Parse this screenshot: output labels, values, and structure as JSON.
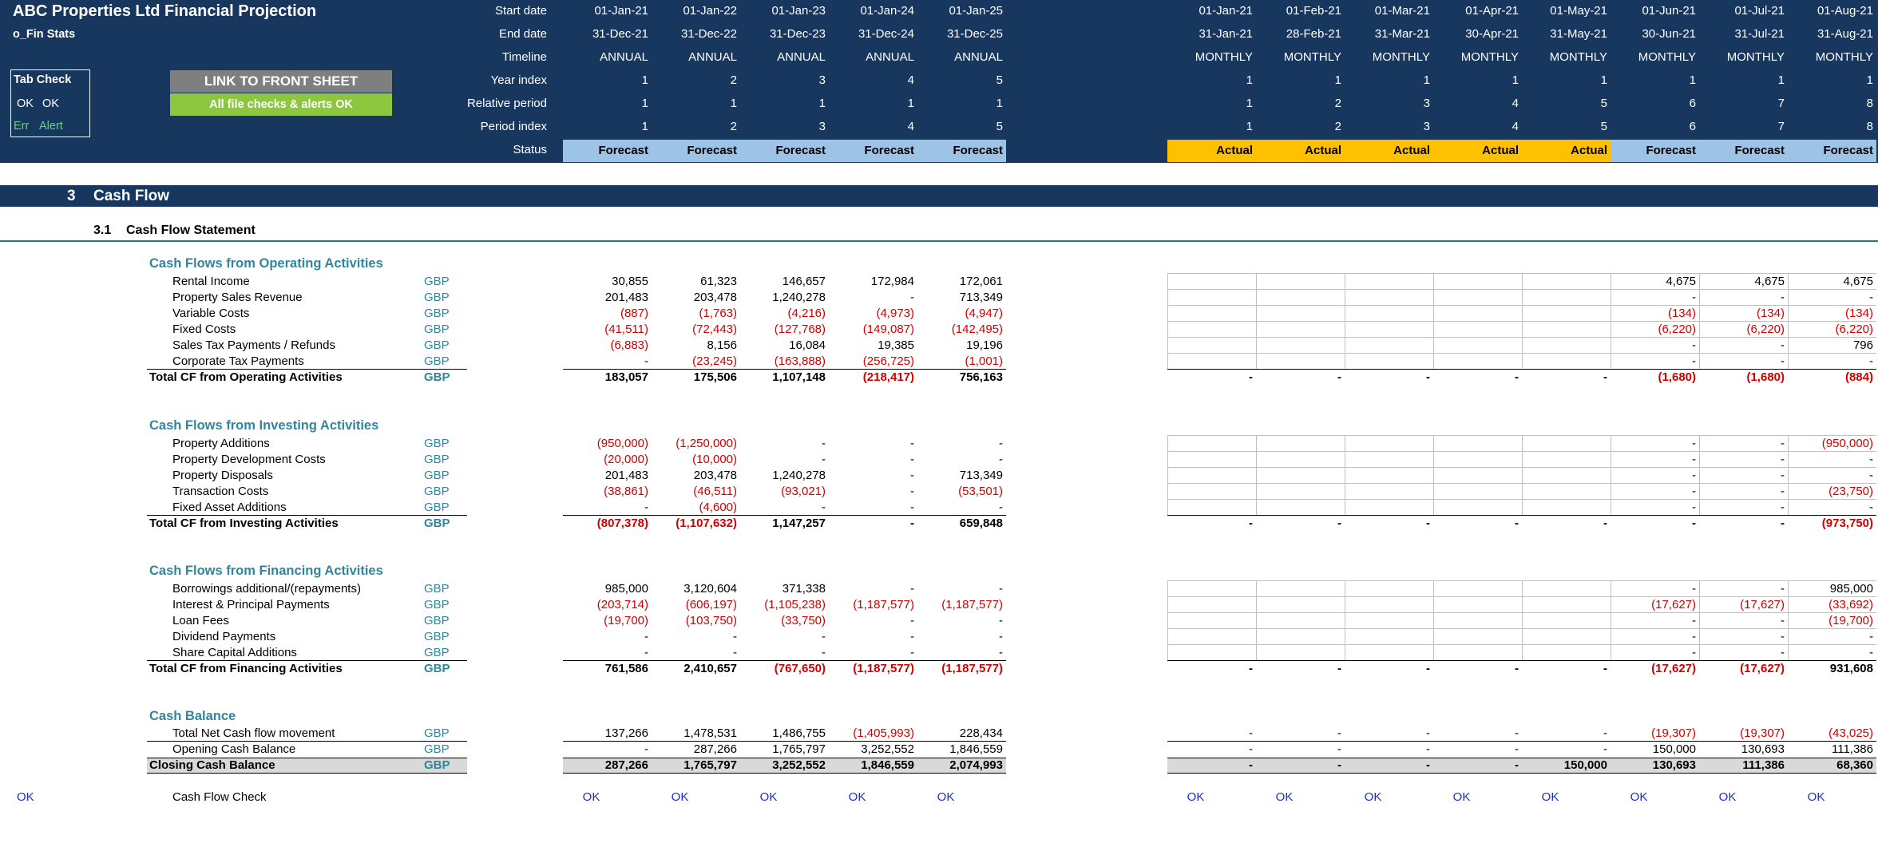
{
  "header": {
    "title": "ABC Properties Ltd Financial Projection",
    "sheet_name": "o_Fin Stats",
    "tab_check_label": "Tab Check",
    "ok1": "OK",
    "ok2": "OK",
    "err_label": "Err",
    "alert_label": "Alert",
    "link_button": "LINK TO FRONT SHEET",
    "checks_button": "All file checks & alerts OK",
    "row_labels": [
      "Start date",
      "End date",
      "Timeline",
      "Year index",
      "Relative period",
      "Period index",
      "Status"
    ]
  },
  "annual_headers": [
    {
      "start": "01-Jan-21",
      "end": "31-Dec-21",
      "timeline": "ANNUAL",
      "year": "1",
      "rel": "1",
      "period": "1",
      "status": "Forecast"
    },
    {
      "start": "01-Jan-22",
      "end": "31-Dec-22",
      "timeline": "ANNUAL",
      "year": "2",
      "rel": "1",
      "period": "2",
      "status": "Forecast"
    },
    {
      "start": "01-Jan-23",
      "end": "31-Dec-23",
      "timeline": "ANNUAL",
      "year": "3",
      "rel": "1",
      "period": "3",
      "status": "Forecast"
    },
    {
      "start": "01-Jan-24",
      "end": "31-Dec-24",
      "timeline": "ANNUAL",
      "year": "4",
      "rel": "1",
      "period": "4",
      "status": "Forecast"
    },
    {
      "start": "01-Jan-25",
      "end": "31-Dec-25",
      "timeline": "ANNUAL",
      "year": "5",
      "rel": "1",
      "period": "5",
      "status": "Forecast"
    }
  ],
  "monthly_headers": [
    {
      "start": "01-Jan-21",
      "end": "31-Jan-21",
      "timeline": "MONTHLY",
      "year": "1",
      "rel": "1",
      "period": "1",
      "status": "Actual"
    },
    {
      "start": "01-Feb-21",
      "end": "28-Feb-21",
      "timeline": "MONTHLY",
      "year": "1",
      "rel": "2",
      "period": "2",
      "status": "Actual"
    },
    {
      "start": "01-Mar-21",
      "end": "31-Mar-21",
      "timeline": "MONTHLY",
      "year": "1",
      "rel": "3",
      "period": "3",
      "status": "Actual"
    },
    {
      "start": "01-Apr-21",
      "end": "30-Apr-21",
      "timeline": "MONTHLY",
      "year": "1",
      "rel": "4",
      "period": "4",
      "status": "Actual"
    },
    {
      "start": "01-May-21",
      "end": "31-May-21",
      "timeline": "MONTHLY",
      "year": "1",
      "rel": "5",
      "period": "5",
      "status": "Actual"
    },
    {
      "start": "01-Jun-21",
      "end": "30-Jun-21",
      "timeline": "MONTHLY",
      "year": "1",
      "rel": "6",
      "period": "6",
      "status": "Forecast"
    },
    {
      "start": "01-Jul-21",
      "end": "31-Jul-21",
      "timeline": "MONTHLY",
      "year": "1",
      "rel": "7",
      "period": "7",
      "status": "Forecast"
    },
    {
      "start": "01-Aug-21",
      "end": "31-Aug-21",
      "timeline": "MONTHLY",
      "year": "1",
      "rel": "8",
      "period": "8",
      "status": "Forecast"
    }
  ],
  "section": {
    "number": "3",
    "title": "Cash Flow",
    "sub_number": "3.1",
    "sub_title": "Cash Flow Statement"
  },
  "colors": {
    "header_bg": "#17375e",
    "forecast": "#9dc3e6",
    "actual": "#ffc000",
    "accent": "#31859c",
    "negative": "#d00000",
    "ok_green": "#8dc63f"
  },
  "groups": [
    {
      "title": "Cash Flows from Operating Activities",
      "rows": [
        {
          "label": "Rental Income",
          "unit": "GBP",
          "annual": [
            "30,855",
            "61,323",
            "146,657",
            "172,984",
            "172,061"
          ],
          "monthly": [
            "",
            "",
            "",
            "",
            "",
            "4,675",
            "4,675",
            "4,675"
          ]
        },
        {
          "label": "Property Sales Revenue",
          "unit": "GBP",
          "annual": [
            "201,483",
            "203,478",
            "1,240,278",
            "-",
            "713,349"
          ],
          "monthly": [
            "",
            "",
            "",
            "",
            "",
            "-",
            "-",
            "-"
          ]
        },
        {
          "label": "Variable Costs",
          "unit": "GBP",
          "annual": [
            "(887)",
            "(1,763)",
            "(4,216)",
            "(4,973)",
            "(4,947)"
          ],
          "monthly": [
            "",
            "",
            "",
            "",
            "",
            "(134)",
            "(134)",
            "(134)"
          ]
        },
        {
          "label": "Fixed Costs",
          "unit": "GBP",
          "annual": [
            "(41,511)",
            "(72,443)",
            "(127,768)",
            "(149,087)",
            "(142,495)"
          ],
          "monthly": [
            "",
            "",
            "",
            "",
            "",
            "(6,220)",
            "(6,220)",
            "(6,220)"
          ]
        },
        {
          "label": "Sales Tax Payments / Refunds",
          "unit": "GBP",
          "annual": [
            "(6,883)",
            "8,156",
            "16,084",
            "19,385",
            "19,196"
          ],
          "monthly": [
            "",
            "",
            "",
            "",
            "",
            "-",
            "-",
            "796"
          ]
        },
        {
          "label": "Corporate Tax Payments",
          "unit": "GBP",
          "annual": [
            "-",
            "(23,245)",
            "(163,888)",
            "(256,725)",
            "(1,001)"
          ],
          "monthly": [
            "",
            "",
            "",
            "",
            "",
            "-",
            "-",
            "-"
          ]
        }
      ],
      "total": {
        "label": "Total CF from Operating Activities",
        "unit": "GBP",
        "annual": [
          "183,057",
          "175,506",
          "1,107,148",
          "(218,417)",
          "756,163"
        ],
        "monthly": [
          "-",
          "-",
          "-",
          "-",
          "-",
          "(1,680)",
          "(1,680)",
          "(884)"
        ]
      }
    },
    {
      "title": "Cash Flows from Investing Activities",
      "rows": [
        {
          "label": "Property Additions",
          "unit": "GBP",
          "annual": [
            "(950,000)",
            "(1,250,000)",
            "-",
            "-",
            "-"
          ],
          "monthly": [
            "",
            "",
            "",
            "",
            "",
            "-",
            "-",
            "(950,000)"
          ]
        },
        {
          "label": "Property Development Costs",
          "unit": "GBP",
          "annual": [
            "(20,000)",
            "(10,000)",
            "-",
            "-",
            "-"
          ],
          "monthly": [
            "",
            "",
            "",
            "",
            "",
            "-",
            "-",
            "-"
          ]
        },
        {
          "label": "Property Disposals",
          "unit": "GBP",
          "annual": [
            "201,483",
            "203,478",
            "1,240,278",
            "-",
            "713,349"
          ],
          "monthly": [
            "",
            "",
            "",
            "",
            "",
            "-",
            "-",
            "-"
          ]
        },
        {
          "label": "Transaction Costs",
          "unit": "GBP",
          "annual": [
            "(38,861)",
            "(46,511)",
            "(93,021)",
            "-",
            "(53,501)"
          ],
          "monthly": [
            "",
            "",
            "",
            "",
            "",
            "-",
            "-",
            "(23,750)"
          ]
        },
        {
          "label": "Fixed Asset Additions",
          "unit": "GBP",
          "annual": [
            "-",
            "(4,600)",
            "-",
            "-",
            "-"
          ],
          "monthly": [
            "",
            "",
            "",
            "",
            "",
            "-",
            "-",
            "-"
          ]
        }
      ],
      "total": {
        "label": "Total CF from Investing Activities",
        "unit": "GBP",
        "annual": [
          "(807,378)",
          "(1,107,632)",
          "1,147,257",
          "-",
          "659,848"
        ],
        "monthly": [
          "-",
          "-",
          "-",
          "-",
          "-",
          "-",
          "-",
          "(973,750)"
        ]
      }
    },
    {
      "title": "Cash Flows from Financing Activities",
      "rows": [
        {
          "label": "Borrowings additional/(repayments)",
          "unit": "GBP",
          "annual": [
            "985,000",
            "3,120,604",
            "371,338",
            "-",
            "-"
          ],
          "monthly": [
            "",
            "",
            "",
            "",
            "",
            "-",
            "-",
            "985,000"
          ]
        },
        {
          "label": "Interest & Principal Payments",
          "unit": "GBP",
          "annual": [
            "(203,714)",
            "(606,197)",
            "(1,105,238)",
            "(1,187,577)",
            "(1,187,577)"
          ],
          "monthly": [
            "",
            "",
            "",
            "",
            "",
            "(17,627)",
            "(17,627)",
            "(33,692)"
          ]
        },
        {
          "label": "Loan Fees",
          "unit": "GBP",
          "annual": [
            "(19,700)",
            "(103,750)",
            "(33,750)",
            "-",
            "-"
          ],
          "monthly": [
            "",
            "",
            "",
            "",
            "",
            "-",
            "-",
            "(19,700)"
          ]
        },
        {
          "label": "Dividend Payments",
          "unit": "GBP",
          "annual": [
            "-",
            "-",
            "-",
            "-",
            "-"
          ],
          "monthly": [
            "",
            "",
            "",
            "",
            "",
            "-",
            "-",
            "-"
          ]
        },
        {
          "label": "Share Capital Additions",
          "unit": "GBP",
          "annual": [
            "-",
            "-",
            "-",
            "-",
            "-"
          ],
          "monthly": [
            "",
            "",
            "",
            "",
            "",
            "-",
            "-",
            "-"
          ]
        }
      ],
      "total": {
        "label": "Total CF from Financing Activities",
        "unit": "GBP",
        "annual": [
          "761,586",
          "2,410,657",
          "(767,650)",
          "(1,187,577)",
          "(1,187,577)"
        ],
        "monthly": [
          "-",
          "-",
          "-",
          "-",
          "-",
          "(17,627)",
          "(17,627)",
          "931,608"
        ]
      }
    }
  ],
  "cash_balance": {
    "title": "Cash Balance",
    "net_movement": {
      "label": "Total Net Cash flow movement",
      "unit": "GBP",
      "annual": [
        "137,266",
        "1,478,531",
        "1,486,755",
        "(1,405,993)",
        "228,434"
      ],
      "monthly": [
        "-",
        "-",
        "-",
        "-",
        "-",
        "(19,307)",
        "(19,307)",
        "(43,025)"
      ]
    },
    "opening": {
      "label": "Opening Cash Balance",
      "unit": "GBP",
      "annual": [
        "-",
        "287,266",
        "1,765,797",
        "3,252,552",
        "1,846,559"
      ],
      "monthly": [
        "-",
        "-",
        "-",
        "-",
        "-",
        "150,000",
        "130,693",
        "111,386"
      ]
    },
    "closing": {
      "label": "Closing Cash Balance",
      "unit": "GBP",
      "annual": [
        "287,266",
        "1,765,797",
        "3,252,552",
        "1,846,559",
        "2,074,993"
      ],
      "monthly": [
        "-",
        "-",
        "-",
        "-",
        "150,000",
        "130,693",
        "111,386",
        "68,360"
      ]
    }
  },
  "check": {
    "left_flag": "OK",
    "label": "Cash Flow Check",
    "annual": [
      "OK",
      "OK",
      "OK",
      "OK",
      "OK"
    ],
    "monthly": [
      "OK",
      "OK",
      "OK",
      "OK",
      "OK",
      "OK",
      "OK",
      "OK"
    ]
  }
}
